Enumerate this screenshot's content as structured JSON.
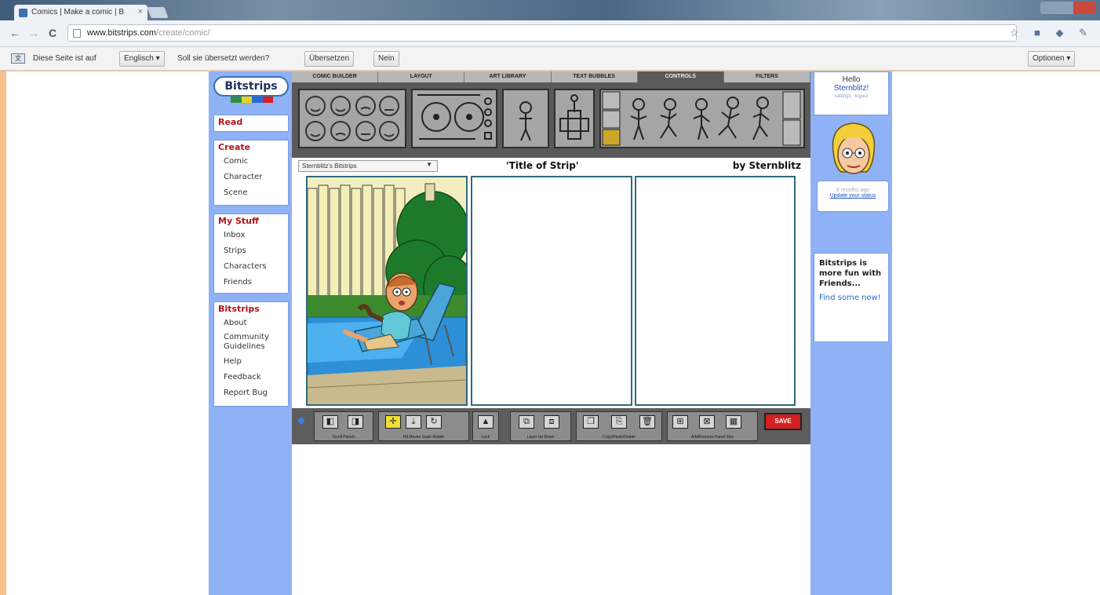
{
  "browser": {
    "tab_title": "Comics | Make a comic | B",
    "tab_close": "×",
    "url_host": "www.bitstrips.com",
    "url_path": "/create/comic/",
    "back_glyph": "←",
    "forward_glyph": "→",
    "reload_glyph": "C",
    "toolbar_icons": "☆ ■ ◆ ✎"
  },
  "translate_bar": {
    "text1": "Diese Seite ist auf",
    "language": "Englisch ▾",
    "text2": "Soll sie übersetzt werden?",
    "translate_btn": "Übersetzen",
    "no_btn": "Nein",
    "options_btn": "Optionen ▾"
  },
  "logo": {
    "text": "Bitstrips"
  },
  "nav": {
    "read": "Read",
    "create": {
      "heading": "Create",
      "items": [
        "Comic",
        "Character",
        "Scene"
      ]
    },
    "mystuff": {
      "heading": "My Stuff",
      "items": [
        "Inbox",
        "Strips",
        "Characters",
        "Friends"
      ]
    },
    "bitstrips": {
      "heading": "Bitstrips",
      "items": [
        "About",
        "Community Guidelines",
        "Help",
        "Feedback",
        "Report Bug"
      ]
    }
  },
  "builder": {
    "tabs": [
      "COMIC BUILDER",
      "LAYOUT",
      "ART LIBRARY",
      "TEXT BUBBLES",
      "CONTROLS",
      "FILTERS"
    ],
    "active_tab": 4
  },
  "strip": {
    "series_select": "Sternblitz's Bitstrips",
    "title": "'Title of Strip'",
    "byline": "by Sternblitz"
  },
  "bottom_toolbar": {
    "groups": [
      "Scroll Panels",
      "Hit Moves  Scale  Rotate",
      "Lock",
      "Layer  Up  Down",
      "Copy/Paste/Delete",
      "Add/Remove Panel  Size"
    ],
    "save_label": "SAVE"
  },
  "right": {
    "hello": "Hello",
    "user": "Sternblitz!",
    "user_links": "settings · logout",
    "avatar_status": "8 months ago",
    "update_link": "Update your status",
    "promo_text": "Bitstrips is more fun with Friends...",
    "promo_link": "Find some now!"
  },
  "colors": {
    "sidebar_blue": "#8fb1f5",
    "nav_heading_red": "#b3121d",
    "save_red": "#d42020",
    "panel_border": "#2f6a7a",
    "desktop_orange": "#f4c08c"
  }
}
